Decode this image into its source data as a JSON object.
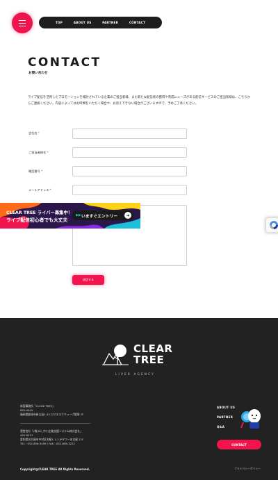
{
  "header": {
    "nav": [
      "TOP",
      "ABOUT US",
      "PARTNER",
      "CONTACT"
    ]
  },
  "page": {
    "title": "CONTACT",
    "subtitle": "お問い合わせ",
    "intro": "ライブ配信を活用したプロモーションを検討されている企業のご担当者様、また新たな配信者の獲得や育成にニーズがある配信サービスのご担当者様は、こちらからご連絡ください。内容によってはお時間をいただく場合や、お答えできない場合がございますので、予めご了承ください。"
  },
  "form": {
    "company": "会社名",
    "person": "ご担当者様名",
    "phone": "電話番号",
    "email": "メールアドレス",
    "required_mark": "*",
    "submit": "送信する"
  },
  "banner": {
    "line1": "CLEAR TREE ライバー募集中！",
    "line2": "ライブ配信初心者でも大丈夫",
    "cta": "いますぐエントリー",
    "arrow": "➜"
  },
  "footer": {
    "logo_line1": "CLEAR",
    "logo_line2": "TREE",
    "tagline": "LIVER AGENCY",
    "office1": {
      "line1": "新宿事務所「CLEAR TREE」",
      "line2": "820-0004",
      "line3": "福岡県飯塚市新立岩3-43 ロマネスクキューブ飯塚 7F"
    },
    "office2": {
      "line1": "運営会社「(株)SO_中小企業支援システム株式会社」",
      "line2": "450-6321",
      "line3": "愛知県名古屋市中村区名駅1-1-1 JPタワー名古屋 21F",
      "line4": "TEL : 052-856-3499 / FAX : 052-856-3222"
    },
    "nav": [
      "ABOUT US",
      "PARTNER",
      "Q&A"
    ],
    "contact_button": "CONTACT",
    "copyright": "Copyright@CLEAR TREE All Rights Reserved.",
    "privacy": "プライバシーポリシー"
  },
  "colors": {
    "accent": "#f0154e",
    "dark": "#222222",
    "nav_bg": "#1e1e1e"
  }
}
